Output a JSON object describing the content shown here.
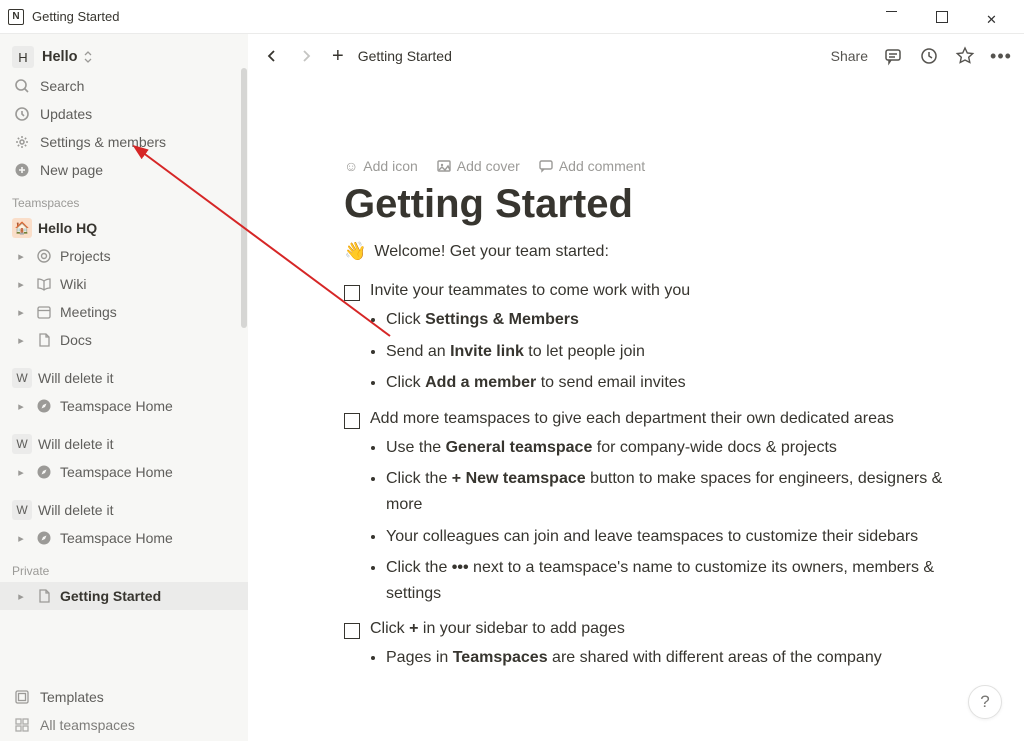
{
  "window": {
    "title": "Getting Started",
    "app_icon_letter": "N"
  },
  "workspace": {
    "badge": "H",
    "name": "Hello"
  },
  "sidebar": {
    "search": "Search",
    "updates": "Updates",
    "settings": "Settings & members",
    "new_page": "New page",
    "teamspaces_label": "Teamspaces",
    "hello_hq": "Hello HQ",
    "projects": "Projects",
    "wiki": "Wiki",
    "meetings": "Meetings",
    "docs": "Docs",
    "ws_a": {
      "letter": "W",
      "name": "Will delete it",
      "home": "Teamspace Home"
    },
    "ws_b": {
      "letter": "W",
      "name": "Will delete it",
      "home": "Teamspace Home"
    },
    "ws_c": {
      "letter": "W",
      "name": "Will delete it",
      "home": "Teamspace Home"
    },
    "private_label": "Private",
    "getting_started": "Getting Started",
    "templates": "Templates",
    "all_teamspaces": "All teamspaces"
  },
  "topbar": {
    "breadcrumb": "Getting Started",
    "share": "Share"
  },
  "page_actions": {
    "add_icon": "Add icon",
    "add_cover": "Add cover",
    "add_comment": "Add comment"
  },
  "page": {
    "title": "Getting Started",
    "welcome": "Welcome! Get your team started:",
    "todo1": "Invite your teammates to come work with you",
    "t1_b1_a": "Click ",
    "t1_b1_b": "Settings & Members",
    "t1_b2_a": "Send an ",
    "t1_b2_b": "Invite link",
    "t1_b2_c": " to let people join",
    "t1_b3_a": "Click ",
    "t1_b3_b": "Add a member",
    "t1_b3_c": " to send email invites",
    "todo2": "Add more teamspaces to give each department their own dedicated areas",
    "t2_b1_a": "Use the ",
    "t2_b1_b": "General teamspace",
    "t2_b1_c": " for company-wide docs & projects",
    "t2_b2_a": "Click the ",
    "t2_b2_b": "+ New teamspace",
    "t2_b2_c": " button to make spaces for engineers, designers & more",
    "t2_b3": "Your colleagues can join and leave teamspaces to customize their sidebars",
    "t2_b4_a": "Click the ",
    "t2_b4_b": "•••",
    "t2_b4_c": " next to a teamspace's name to customize its owners, members & settings",
    "todo3_a": "Click ",
    "todo3_b": "+",
    "todo3_c": " in your sidebar to add pages",
    "t3_b1_a": "Pages in ",
    "t3_b1_b": "Teamspaces",
    "t3_b1_c": " are shared with different areas of the company"
  }
}
